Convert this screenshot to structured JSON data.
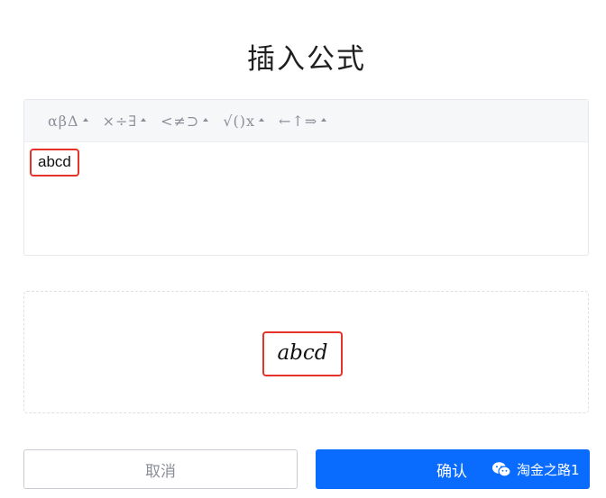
{
  "dialog": {
    "title": "插入公式"
  },
  "toolbar": {
    "groups": [
      {
        "glyphs": "αβΔ",
        "icon": "greek-letters-icon"
      },
      {
        "glyphs": "×÷∃",
        "icon": "operators-icon"
      },
      {
        "glyphs": "<≠⊃",
        "icon": "relations-icon"
      },
      {
        "glyphs": "√()x",
        "icon": "functions-icon"
      },
      {
        "glyphs": "←↑⇒",
        "icon": "arrows-icon"
      }
    ]
  },
  "editor": {
    "input_value": "abcd"
  },
  "preview": {
    "rendered": "abcd"
  },
  "buttons": {
    "cancel_label": "取消",
    "confirm_label": "确认"
  },
  "watermark": {
    "text": "淘金之路1"
  },
  "colors": {
    "primary": "#0a6cff",
    "highlight": "#e5332a",
    "muted": "#8a8f99"
  }
}
